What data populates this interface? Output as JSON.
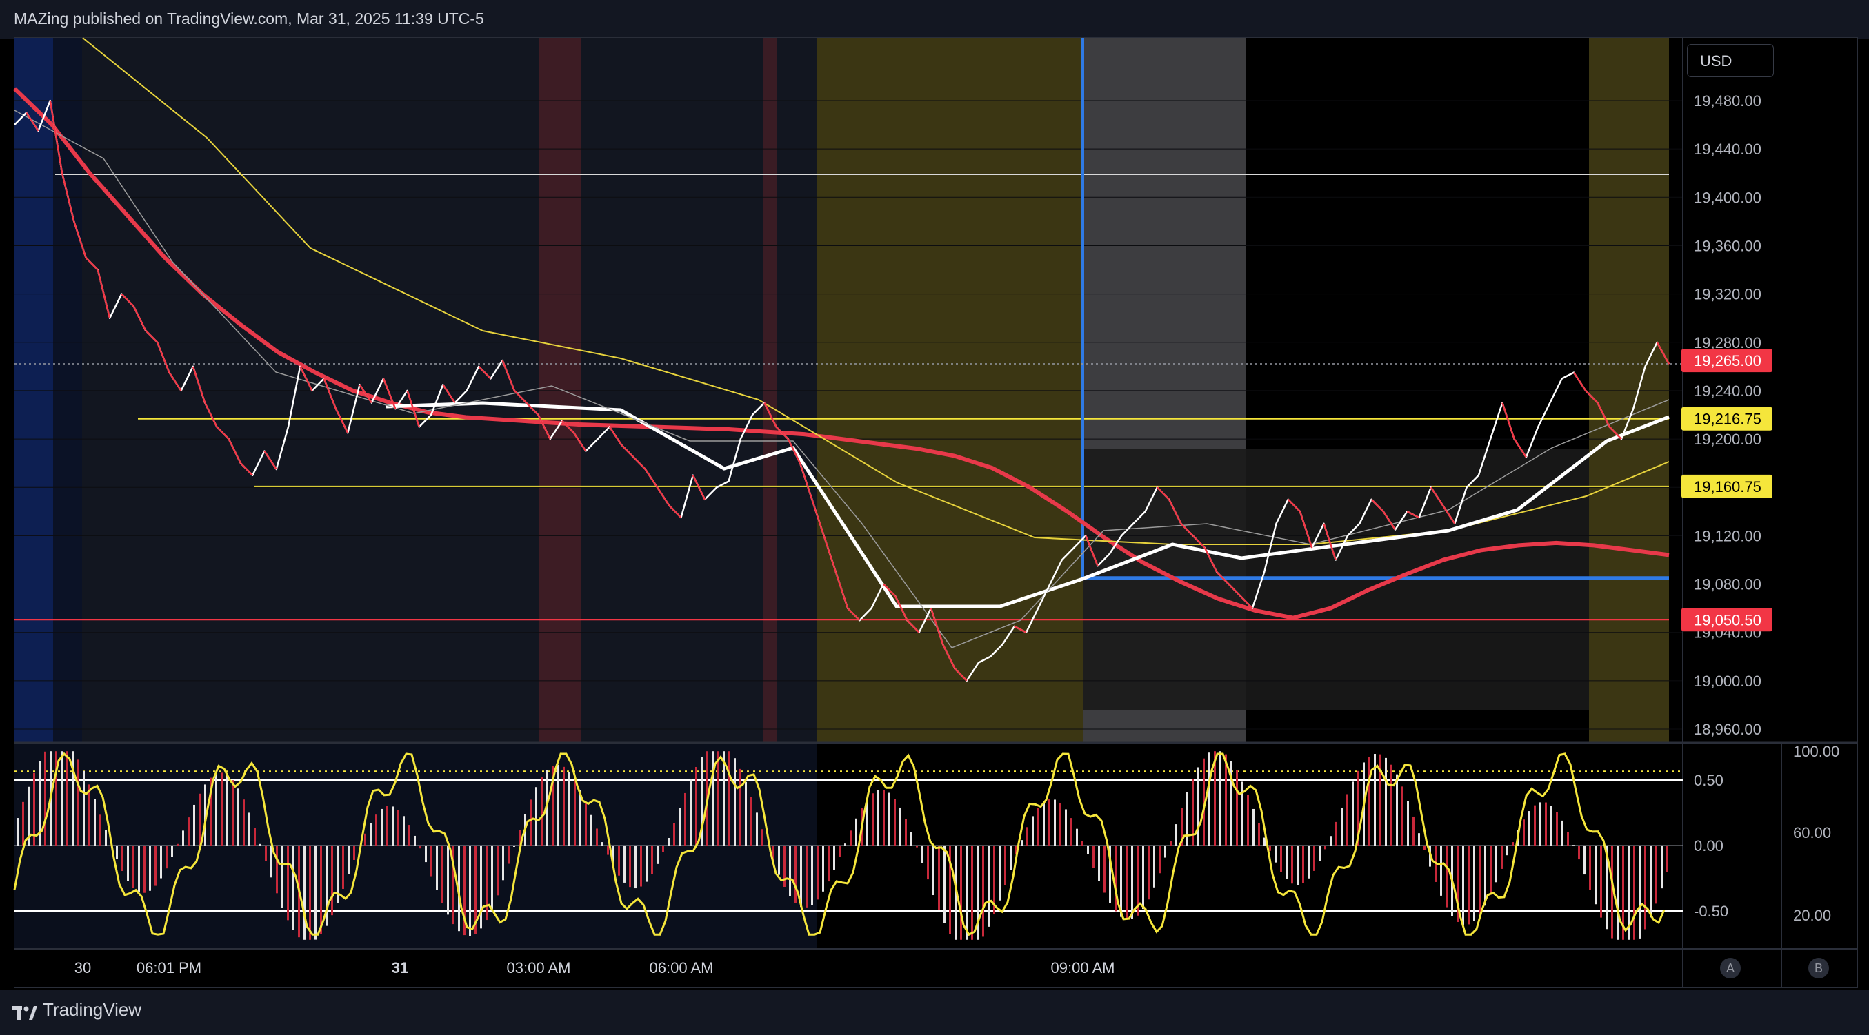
{
  "header": {
    "published": "MAZing published on TradingView.com, Mar 31, 2025 11:39 UTC-5"
  },
  "footer": {
    "brand": "TradingView"
  },
  "scale": {
    "currency": "USD",
    "btn_a": "A",
    "btn_b": "B"
  },
  "chart_data": [
    {
      "type": "line",
      "yticks": [
        "19,480.00",
        "19,440.00",
        "19,400.00",
        "19,360.00",
        "19,320.00",
        "19,280.00",
        "19,240.00",
        "19,200.00",
        "19,160.00",
        "19,120.00",
        "19,080.00",
        "19,040.00",
        "19,000.00",
        "18,960.00"
      ],
      "ylim": [
        18950,
        19520
      ],
      "xticks": [
        "30",
        "06:01 PM",
        "31",
        "03:00 AM",
        "06:00 AM",
        "09:00 AM"
      ],
      "price_labels": [
        {
          "label": "19,265.00",
          "value": 19265.0,
          "color": "#f23645"
        },
        {
          "label": "19,216.75",
          "value": 19216.75,
          "color": "#f5e63b"
        },
        {
          "label": "19,160.75",
          "value": 19160.75,
          "color": "#f5e63b"
        },
        {
          "label": "19,050.50",
          "value": 19050.5,
          "color": "#f23645"
        }
      ],
      "hlines": [
        {
          "value": 19419,
          "color": "#d9d9d9"
        },
        {
          "value": 19216.75,
          "color": "#f5e63b"
        },
        {
          "value": 19160.75,
          "color": "#f5e63b"
        },
        {
          "value": 19050.5,
          "color": "#f23645"
        },
        {
          "value": 19085,
          "color": "#2f7ae5"
        }
      ],
      "series": [
        {
          "values": [
            19460,
            19470,
            19455,
            19480,
            19420,
            19380,
            19350,
            19340,
            19300,
            19320,
            19310,
            19290,
            19280,
            19255,
            19240,
            19260,
            19230,
            19210,
            19200,
            19180,
            19170,
            19190,
            19175,
            19210,
            19260,
            19240,
            19250,
            19225,
            19205,
            19245,
            19230,
            19250,
            19225,
            19240,
            19210,
            19220,
            19245,
            19230,
            19240,
            19260,
            19250,
            19265,
            19240,
            19230,
            19220,
            19200,
            19215,
            19205,
            19190,
            19200,
            19210,
            19195,
            19185,
            19175,
            19160,
            19145,
            19135,
            19170,
            19150,
            19160,
            19165,
            19200,
            19220,
            19230,
            19210,
            19200,
            19180,
            19150,
            19120,
            19090,
            19060,
            19050,
            19060,
            19080,
            19070,
            19050,
            19040,
            19060,
            19030,
            19010,
            19000,
            19015,
            19020,
            19030,
            19045,
            19040,
            19060,
            19080,
            19100,
            19110,
            19120,
            19095,
            19105,
            19120,
            19130,
            19140,
            19160,
            19150,
            19130,
            19120,
            19110,
            19090,
            19080,
            19070,
            19060,
            19090,
            19130,
            19150,
            19140,
            19110,
            19130,
            19100,
            19120,
            19130,
            19150,
            19140,
            19125,
            19140,
            19135,
            19160,
            19145,
            19130,
            19160,
            19170,
            19200,
            19230,
            19200,
            19185,
            19210,
            19230,
            19250,
            19255,
            19240,
            19230,
            19210,
            19200,
            19225,
            19260,
            19280,
            19262
          ]
        },
        {
          "name": "",
          "values": [
            19490,
            19460,
            19420,
            19385,
            19350,
            19320,
            19295,
            19272,
            19255,
            19240,
            19230,
            19222,
            19218,
            19216,
            19214,
            19212,
            19211,
            19210,
            19209,
            19208,
            19206,
            19204,
            19200,
            19196,
            19192,
            19186,
            19176,
            19160,
            19140,
            19118,
            19098,
            19082,
            19068,
            19058,
            19052,
            19060,
            19075,
            19088,
            19100,
            19108,
            19112,
            19114,
            19112,
            19108,
            19104
          ]
        }
      ]
    },
    {
      "type": "bar",
      "yticks": [
        "0.50",
        "0.00",
        "-0.50"
      ],
      "yticks_right": [
        "100.00",
        "60.00",
        "20.00"
      ],
      "ylim": [
        -0.75,
        0.75
      ]
    }
  ]
}
